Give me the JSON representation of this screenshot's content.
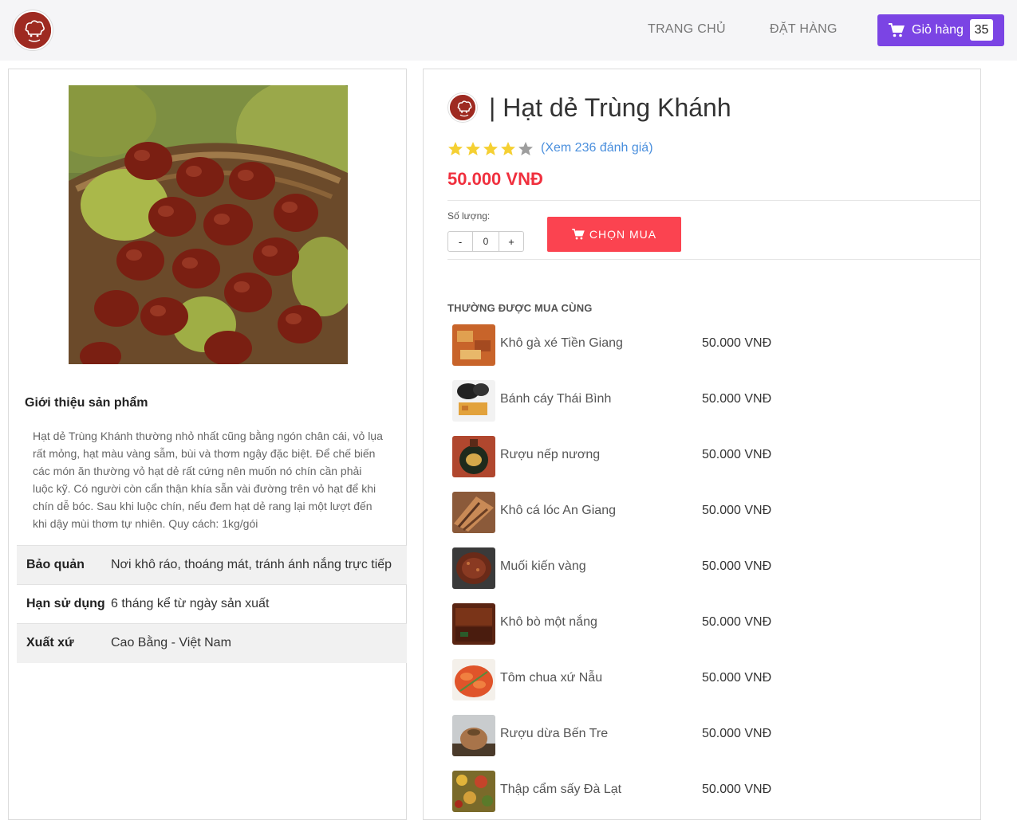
{
  "nav": {
    "logo_icon": "chef-logo-icon",
    "home_label": "TRANG CHỦ",
    "order_label": "ĐẶT HÀNG",
    "cart_label": "Giỏ hàng",
    "cart_count": "35",
    "accent_color": "#7b44e4"
  },
  "product": {
    "title": "| Hạt dẻ Trùng Khánh",
    "rating": 4,
    "rating_max": 5,
    "review_link": "(Xem 236 đánh giá)",
    "price": "50.000 VNĐ",
    "price_color": "#f0303e",
    "quantity_label": "Số lượng:",
    "quantity_value": "0",
    "decrement_label": "-",
    "increment_label": "+",
    "buy_label": "CHỌN MUA",
    "buy_color": "#fb4350"
  },
  "intro": {
    "title": "Giới thiệu sản phẩm",
    "text": "Hạt dẻ Trùng Khánh thường nhỏ nhất cũng bằng ngón chân cái, vỏ lụa rất mỏng, hạt màu vàng sẫm, bùi và thơm ngậy đặc biệt. Để chế biến các món ăn thường vỏ hạt dẻ rất cứng nên muốn nó chín cần phải luộc kỹ. Có người còn cẩn thận khía sẵn vài đường trên vỏ hạt để khi chín dễ bóc. Sau khi luộc chín, nếu đem hạt dẻ rang lại một lượt đến khi dậy mùi thơm tự nhiên. Quy cách: 1kg/gói"
  },
  "specs": [
    {
      "key": "Bảo quản",
      "value": "Nơi khô ráo, thoáng mát, tránh ánh nắng trực tiếp"
    },
    {
      "key": "Hạn sử dụng",
      "value": "6 tháng kể từ ngày sản xuất"
    },
    {
      "key": "Xuất xứ",
      "value": "Cao Bằng - Việt Nam"
    }
  ],
  "related": {
    "title": "THƯỜNG ĐƯỢC MUA CÙNG",
    "items": [
      {
        "name": "Khô gà xé Tiền Giang",
        "price": "50.000 VNĐ"
      },
      {
        "name": "Bánh cáy Thái Bình",
        "price": "50.000 VNĐ"
      },
      {
        "name": "Rượu nếp nương",
        "price": "50.000 VNĐ"
      },
      {
        "name": "Khô cá lóc An Giang",
        "price": "50.000 VNĐ"
      },
      {
        "name": "Muối kiến vàng",
        "price": "50.000 VNĐ"
      },
      {
        "name": "Khô bò một nắng",
        "price": "50.000 VNĐ"
      },
      {
        "name": "Tôm chua xứ Nẫu",
        "price": "50.000 VNĐ"
      },
      {
        "name": "Rượu dừa Bến Tre",
        "price": "50.000 VNĐ"
      },
      {
        "name": "Thập cẩm sấy Đà Lạt",
        "price": "50.000 VNĐ"
      }
    ]
  }
}
